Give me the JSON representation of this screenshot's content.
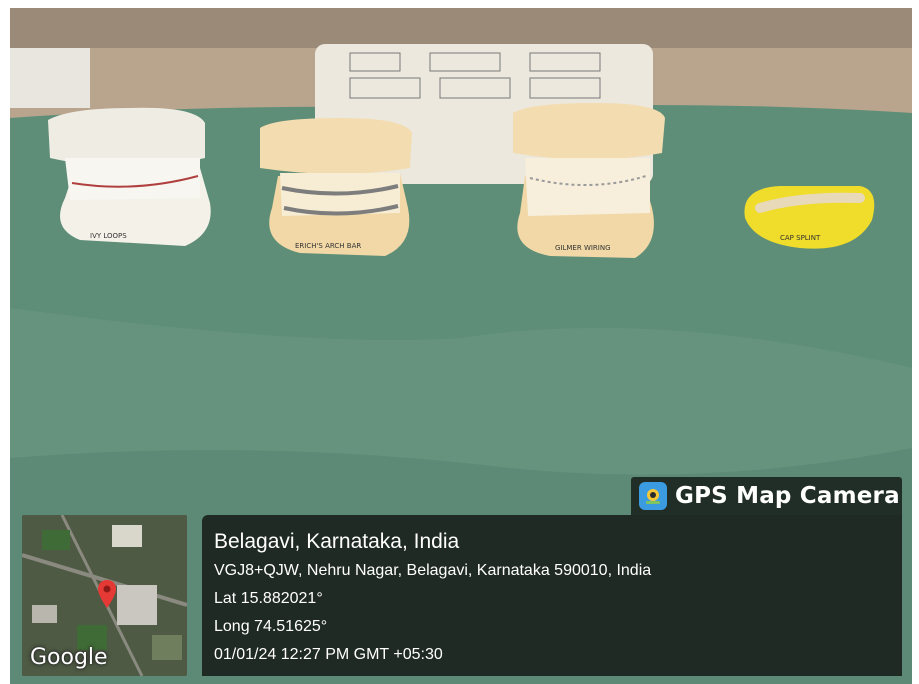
{
  "photo": {
    "models": [
      {
        "label": "IVY LOOPS"
      },
      {
        "label": "ERICH'S ARCH BAR"
      },
      {
        "label": "GILMER WIRING"
      },
      {
        "label": "CAP SPLINT"
      }
    ]
  },
  "stamp": {
    "app_name": "GPS Map Camera",
    "place": "Belagavi, Karnataka, India",
    "address": "VGJ8+QJW, Nehru Nagar, Belagavi, Karnataka 590010, India",
    "latitude": "Lat 15.882021°",
    "longitude": "Long 74.51625°",
    "datetime": "01/01/24 12:27 PM GMT +05:30",
    "map_brand": "Google"
  },
  "colors": {
    "drape": "#5f8e78",
    "stamp_bg": "#141816",
    "pin": "#e53935"
  },
  "icons": [
    "camera-app-icon",
    "location-pin-icon"
  ]
}
